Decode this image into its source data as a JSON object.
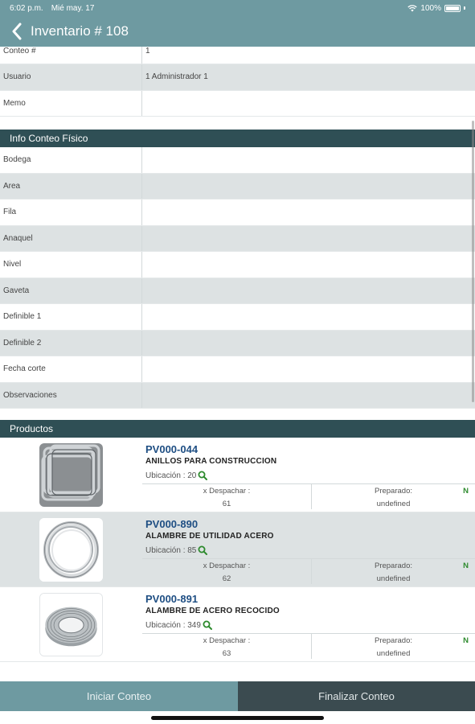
{
  "status": {
    "time": "6:02 p.m.",
    "date": "Mié may. 17",
    "battery": "100%"
  },
  "nav": {
    "title": "Inventario # 108"
  },
  "header_fields": [
    {
      "label": "Conteo #",
      "value": "1"
    },
    {
      "label": "Usuario",
      "value": "1 Administrador 1"
    },
    {
      "label": "Memo",
      "value": ""
    }
  ],
  "info_section": {
    "title": "Info Conteo Físico",
    "fields": [
      {
        "label": "Bodega",
        "value": ""
      },
      {
        "label": "Area",
        "value": ""
      },
      {
        "label": "Fila",
        "value": ""
      },
      {
        "label": "Anaquel",
        "value": ""
      },
      {
        "label": "Nivel",
        "value": ""
      },
      {
        "label": "Gaveta",
        "value": ""
      },
      {
        "label": "Definible 1",
        "value": ""
      },
      {
        "label": "Definible 2",
        "value": ""
      },
      {
        "label": "Fecha corte",
        "value": ""
      },
      {
        "label": "Observaciones",
        "value": ""
      }
    ]
  },
  "products_section": {
    "title": "Productos",
    "items": [
      {
        "code": "PV000-044",
        "name": "ANILLOS PARA CONSTRUCCION",
        "ubicacion": "Ubicación : 20",
        "despachar_label": "x Despachar :",
        "despachar_value": "61",
        "preparado_label": "Preparado:",
        "preparado_value": "undefined",
        "flag": "N",
        "image": "rebar-rings"
      },
      {
        "code": "PV000-890",
        "name": "ALAMBRE DE UTILIDAD ACERO",
        "ubicacion": "Ubicación : 85",
        "despachar_label": "x Despachar :",
        "despachar_value": "62",
        "preparado_label": "Preparado:",
        "preparado_value": "undefined",
        "flag": "N",
        "image": "wire-coil"
      },
      {
        "code": "PV000-891",
        "name": "ALAMBRE DE ACERO RECOCIDO",
        "ubicacion": "Ubicación : 349",
        "despachar_label": "x Despachar :",
        "despachar_value": "63",
        "preparado_label": "Preparado:",
        "preparado_value": "undefined",
        "flag": "N",
        "image": "annealed-wire-roll"
      }
    ]
  },
  "footer": {
    "start_label": "Iniciar Conteo",
    "end_label": "Finalizar Conteo"
  },
  "colors": {
    "header": "#6e9aa1",
    "section": "#2f4f55",
    "code": "#1e4e83",
    "flag": "#2d8a2d",
    "footer_dark": "#3b4b50"
  }
}
